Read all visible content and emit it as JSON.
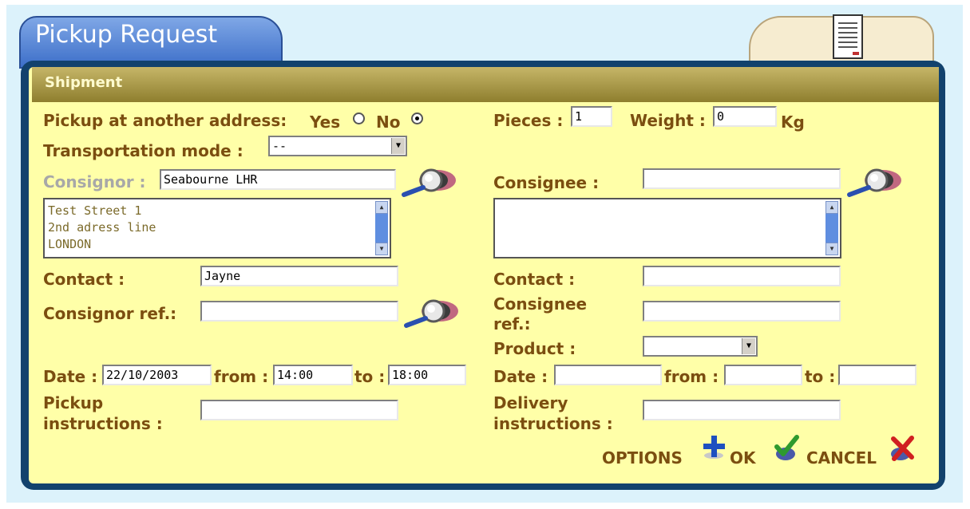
{
  "header": {
    "title": "Pickup Request"
  },
  "section": {
    "title": "Shipment"
  },
  "left": {
    "pickup_label": "Pickup at another address:",
    "yes_label": "Yes",
    "no_label": "No",
    "transport_label": "Transportation mode :",
    "transport_value": "--",
    "consignor_label": "Consignor :",
    "consignor_value": "Seabourne LHR",
    "address": [
      "Test Street 1",
      "2nd adress line",
      "LONDON"
    ],
    "contact_label": "Contact :",
    "contact_value": "Jayne",
    "ref_label": "Consignor ref.:",
    "ref_value": "",
    "date_label": "Date :",
    "date_value": "22/10/2003",
    "from_label": "from :",
    "from_value": "14:00",
    "to_label": "to :",
    "to_value": "18:00",
    "instr_label_1": "Pickup",
    "instr_label_2": "instructions :",
    "instr_value": ""
  },
  "right": {
    "pieces_label": "Pieces :",
    "pieces_value": "1",
    "weight_label": "Weight :",
    "weight_value": "0",
    "weight_unit": "Kg",
    "consignee_label": "Consignee :",
    "consignee_value": "",
    "contact_label": "Contact :",
    "contact_value": "",
    "ref_label_1": "Consignee",
    "ref_label_2": "ref.:",
    "ref_value": "",
    "product_label": "Product :",
    "product_value": "",
    "date_label": "Date :",
    "date_value": "",
    "from_label": "from :",
    "from_value": "",
    "to_label": "to :",
    "to_value": "",
    "instr_label_1": "Delivery",
    "instr_label_2": "instructions :",
    "instr_value": ""
  },
  "actions": {
    "options": "OPTIONS",
    "ok": "OK",
    "cancel": "CANCEL"
  },
  "colors": {
    "panel": "#ffffa8",
    "frame": "#12426d",
    "label": "#7b4e10",
    "tab": "#3d6fc9",
    "background": "#dcf2fb"
  }
}
